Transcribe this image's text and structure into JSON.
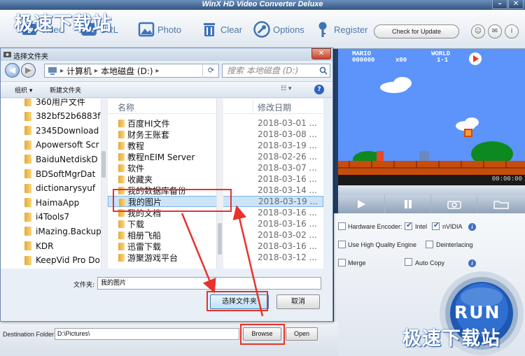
{
  "app": {
    "title": "WinX HD Video Converter Deluxe",
    "toolbar": [
      {
        "name": "video",
        "label": "Video",
        "icon": "video-plus-icon"
      },
      {
        "name": "url",
        "label": "URL",
        "icon": "youtube-icon"
      },
      {
        "name": "photo",
        "label": "Photo",
        "icon": "photo-icon"
      },
      {
        "name": "clear",
        "label": "Clear",
        "icon": "trash-icon"
      },
      {
        "name": "options",
        "label": "Options",
        "icon": "wrench-icon"
      },
      {
        "name": "register",
        "label": "Register",
        "icon": "key-icon"
      }
    ],
    "check_update_label": "Check for Update",
    "preview_time": "00:00:00",
    "hud": {
      "mario": "MARIO",
      "score": "000000",
      "coins": "x00",
      "world_label": "WORLD",
      "world": "1-1"
    },
    "options": {
      "hw_encoder_label": "Hardware Encoder:",
      "intel_label": "Intel",
      "nvidia_label": "nVIDIA",
      "hq_engine_label": "Use High Quality Engine",
      "deinterlacing_label": "Deinterlacing",
      "merge_label": "Merge",
      "autocopy_label": "Auto Copy",
      "intel_checked": true,
      "nvidia_checked": true,
      "hq_engine_checked": false,
      "deinterlacing_checked": false,
      "merge_checked": false,
      "autocopy_checked": false
    },
    "run_label": "RUN",
    "destination": {
      "label": "Destination Folder:",
      "value": "D:\\Pictures\\",
      "browse_label": "Browse",
      "open_label": "Open"
    }
  },
  "dialog": {
    "title": "选择文件夹",
    "address": [
      "计算机",
      "本地磁盘 (D:)"
    ],
    "search_placeholder": "搜索 本地磁盘 (D:)",
    "organize_label": "组织",
    "new_folder_label": "新建文件夹",
    "left_folders": [
      "360用户文件",
      "382bf52b6883f",
      "2345Download",
      "Apowersoft Scr",
      "BaiduNetdiskD",
      "BDSoftMgrDat",
      "dictionarysyuf",
      "HaimaApp",
      "i4Tools7",
      "iMazing.Backup",
      "KDR",
      "KeepVid Pro Do"
    ],
    "columns": {
      "name": "名称",
      "date": "修改日期"
    },
    "files": [
      {
        "name": "百度HI文件",
        "date": "2018-03-01 ..."
      },
      {
        "name": "财务王账套",
        "date": "2018-03-08 ..."
      },
      {
        "name": "教程",
        "date": "2018-03-19 ..."
      },
      {
        "name": "教程nEIM Server",
        "date": "2018-02-26 ..."
      },
      {
        "name": "软件",
        "date": "2018-03-07 ..."
      },
      {
        "name": "收藏夹",
        "date": "2018-03-16 ..."
      },
      {
        "name": "我的数据库备份",
        "date": "2018-03-14 ..."
      },
      {
        "name": "我的图片",
        "date": "2018-03-19 ..."
      },
      {
        "name": "我的文档",
        "date": "2018-03-16 ..."
      },
      {
        "name": "下载",
        "date": "2018-03-16 ..."
      },
      {
        "name": "相册飞船",
        "date": "2018-03-02 ..."
      },
      {
        "name": "迅雷下载",
        "date": "2018-03-16 ..."
      },
      {
        "name": "游聚游戏平台",
        "date": "2018-03-12 ..."
      }
    ],
    "selected_index": 7,
    "filename_label": "文件夹:",
    "filename_value": "我的图片",
    "ok_label": "选择文件夹",
    "cancel_label": "取消"
  },
  "watermark": "极速下载站",
  "colors": {
    "accent": "#3d70c4",
    "annotation": "#e8322b",
    "selection": "#cce4f7"
  }
}
